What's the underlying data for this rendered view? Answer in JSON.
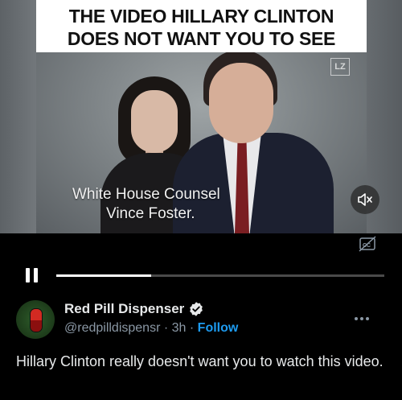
{
  "video": {
    "headline_line1": "THE VIDEO HILLARY CLINTON",
    "headline_line2": "DOES NOT WANT YOU TO SEE",
    "watermark": "LZ",
    "lower_third_line1": "White House Counsel",
    "lower_third_line2": "Vince Foster.",
    "progress_fraction": 0.29
  },
  "post": {
    "display_name": "Red Pill Dispenser",
    "handle": "@redpilldispensr",
    "separator": "·",
    "time": "3h",
    "follow_label": "Follow",
    "text": "Hillary Clinton really doesn't want you to watch this video."
  },
  "icons": {
    "mute": "speaker-muted-icon",
    "captions": "captions-off-icon",
    "pause": "pause-icon",
    "verified": "verified-badge-icon",
    "more": "more-icon"
  },
  "colors": {
    "accent": "#1d9bf0",
    "background": "#000000",
    "text": "#e7e9ea",
    "muted": "#8b98a5"
  }
}
